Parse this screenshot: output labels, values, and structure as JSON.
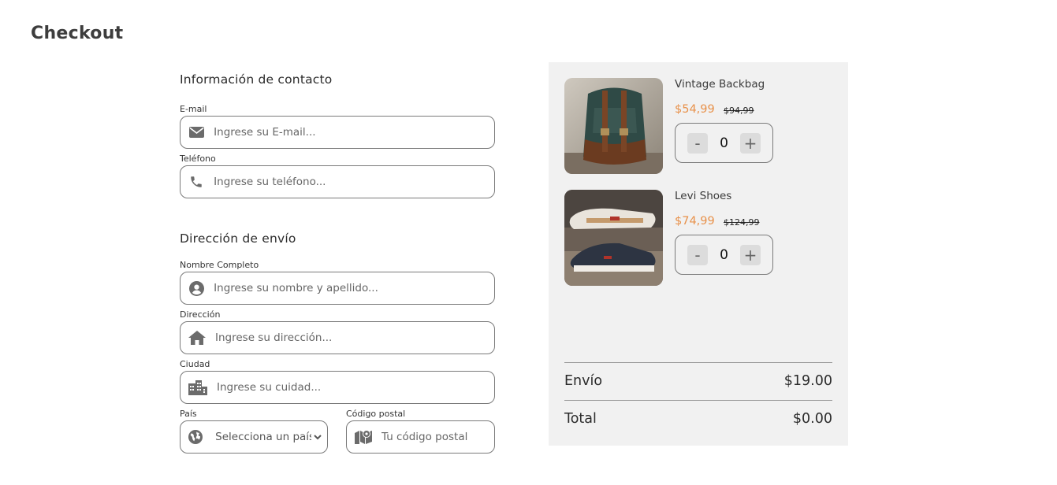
{
  "page": {
    "title": "Checkout"
  },
  "contact": {
    "title": "Información de contacto",
    "email": {
      "label": "E-mail",
      "placeholder": "Ingrese su E-mail..."
    },
    "phone": {
      "label": "Teléfono",
      "placeholder": "Ingrese su teléfono..."
    }
  },
  "shipping": {
    "title": "Dirección de envío",
    "fullname": {
      "label": "Nombre Completo",
      "placeholder": "Ingrese su nombre y apellido..."
    },
    "address": {
      "label": "Dirección",
      "placeholder": "Ingrese su dirección..."
    },
    "city": {
      "label": "Ciudad",
      "placeholder": "Ingrese su cuidad..."
    },
    "country": {
      "label": "País",
      "selected": "Selecciona un país"
    },
    "postal": {
      "label": "Código postal",
      "placeholder": "Tu código postal"
    }
  },
  "cart": {
    "items": [
      {
        "name": "Vintage Backbag",
        "price": "$54,99",
        "old_price": "$94,99",
        "qty": "0",
        "minus": "-",
        "plus": "+"
      },
      {
        "name": "Levi Shoes",
        "price": "$74,99",
        "old_price": "$124,99",
        "qty": "0",
        "minus": "-",
        "plus": "+"
      }
    ],
    "shipping_label": "Envío",
    "shipping_value": "$19.00",
    "total_label": "Total",
    "total_value": "$0.00"
  },
  "colors": {
    "accent": "#e8914a",
    "cart_bg": "#f1f1f1",
    "icon": "#6b6b6b"
  },
  "icons": [
    "envelope-icon",
    "phone-icon",
    "user-circle-icon",
    "home-icon",
    "city-icon",
    "globe-icon",
    "map-pin-icon"
  ]
}
